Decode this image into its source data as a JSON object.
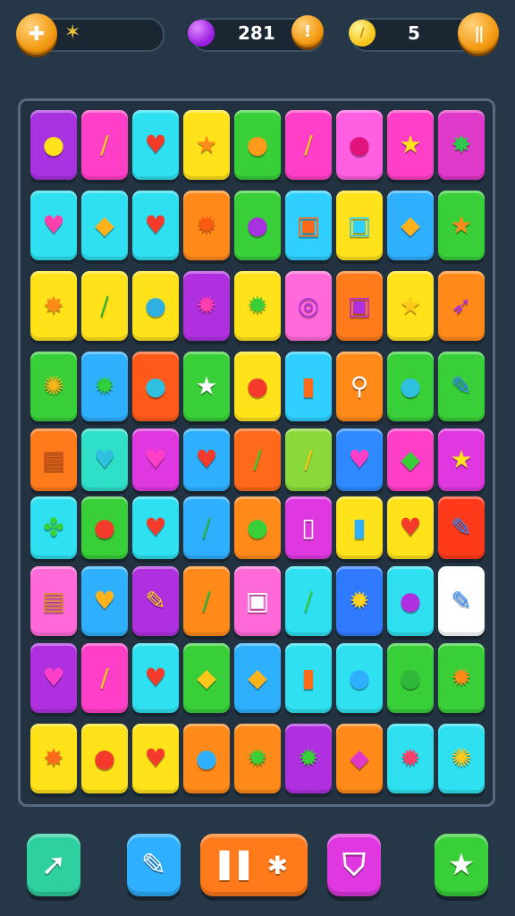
{
  "hud": {
    "left": {
      "button_icon": "plus-icon",
      "button_glyph": "✚",
      "badge_icon": "sparkle-icon",
      "badge_glyph": "✶"
    },
    "center": {
      "gem_icon": "purple-gem-icon",
      "value": "281",
      "button_icon": "info-icon",
      "button_glyph": "!"
    },
    "right": {
      "coin_icon": "gold-coin-icon",
      "coin_glyph": "/",
      "value": "5",
      "button_icon": "pause-icon",
      "button_glyph": "||"
    }
  },
  "board": {
    "rows": [
      [
        [
          "#a832e0",
          "lemon-icon",
          "●",
          "#ffe21a"
        ],
        [
          "#ff3fc8",
          "banana-icon",
          "/",
          "#ffd21f"
        ],
        [
          "#2fe0f0",
          "heart-icon",
          "♥",
          "#f43a2a"
        ],
        [
          "#ffe21a",
          "star-icon",
          "★",
          "#ff8a1a"
        ],
        [
          "#39cf39",
          "orange-icon",
          "●",
          "#ff9a1a"
        ],
        [
          "#ff3fc8",
          "banana-icon",
          "/",
          "#ffd21f"
        ],
        [
          "#ff5fe0",
          "berry-icon",
          "●",
          "#e0147a"
        ],
        [
          "#ff3fc8",
          "star-icon",
          "★",
          "#ffe21a"
        ],
        [
          "#e038c8",
          "leaf-star-icon",
          "✸",
          "#2fc84a"
        ]
      ],
      [
        [
          "#2fe0f0",
          "heart-icon",
          "♥",
          "#ff3fae"
        ],
        [
          "#2fe0f0",
          "leaf-icon",
          "◆",
          "#ffb21a"
        ],
        [
          "#2fe0f0",
          "heart-icon",
          "♥",
          "#f43a2a"
        ],
        [
          "#ff8a1a",
          "burst-icon",
          "✹",
          "#ff5a12"
        ],
        [
          "#39cf39",
          "potion-icon",
          "●",
          "#a832e0"
        ],
        [
          "#2fd0ff",
          "jar-icon",
          "▣",
          "#ff6a1a"
        ],
        [
          "#ffe21a",
          "jar-icon",
          "▣",
          "#2fd0ff"
        ],
        [
          "#2fb0ff",
          "leaf-icon",
          "◆",
          "#ffb21a"
        ],
        [
          "#39cf39",
          "star-icon",
          "★",
          "#ff8a1a"
        ]
      ],
      [
        [
          "#ffe21a",
          "leaf-star-icon",
          "✸",
          "#ff8a1a"
        ],
        [
          "#ffe21a",
          "cucumber-icon",
          "/",
          "#2fb83a"
        ],
        [
          "#ffe21a",
          "splash-icon",
          "●",
          "#2fb0e0"
        ],
        [
          "#b030e0",
          "burst-icon",
          "✹",
          "#ff3fae"
        ],
        [
          "#ffe21a",
          "burst-icon",
          "✹",
          "#39cf39"
        ],
        [
          "#ff6ad8",
          "ring-icon",
          "◎",
          "#b030e0"
        ],
        [
          "#ff7a1a",
          "ring-icon",
          "▣",
          "#b030e0"
        ],
        [
          "#ffe21a",
          "star-icon",
          "★",
          "#ffc81a"
        ],
        [
          "#ff8a1a",
          "rocket-icon",
          "➶",
          "#b030e0"
        ]
      ],
      [
        [
          "#39cf39",
          "gear-icon",
          "✺",
          "#ffb21a"
        ],
        [
          "#2fb0ff",
          "burst-icon",
          "✹",
          "#2fd03a"
        ],
        [
          "#ff5a1a",
          "splash-icon",
          "●",
          "#2fc0e0"
        ],
        [
          "#39cf39",
          "star-icon",
          "★",
          "#ffffff"
        ],
        [
          "#ffe21a",
          "strawberry-icon",
          "●",
          "#f43a2a"
        ],
        [
          "#2fd0ff",
          "bottle-icon",
          "▮",
          "#ff6a1a"
        ],
        [
          "#ff8a1a",
          "key-icon",
          "⚲",
          "#ffffff"
        ],
        [
          "#39cf39",
          "splash-icon",
          "●",
          "#2fc0e0"
        ],
        [
          "#39cf39",
          "pencil-icon",
          "✎",
          "#2f8aff"
        ]
      ],
      [
        [
          "#ff7a1a",
          "chocolate-icon",
          "▤",
          "#c8501a"
        ],
        [
          "#2fe0c8",
          "heart-icon",
          "♥",
          "#2fc0e0"
        ],
        [
          "#e038e0",
          "heart-icon",
          "♥",
          "#ff3fc8"
        ],
        [
          "#2fb0ff",
          "heart-icon",
          "♥",
          "#f43a2a"
        ],
        [
          "#ff6a1a",
          "cucumber-icon",
          "/",
          "#39cf39"
        ],
        [
          "#8ad83a",
          "banana-icon",
          "/",
          "#ffc81a"
        ],
        [
          "#2f8aff",
          "heart-icon",
          "♥",
          "#ff3fc8"
        ],
        [
          "#ff3fc8",
          "leaf-icon",
          "◆",
          "#39cf39"
        ],
        [
          "#e038e0",
          "star-icon",
          "★",
          "#ffe21a"
        ]
      ],
      [
        [
          "#2fe0f0",
          "popsicle-icon",
          "✤",
          "#39cf39"
        ],
        [
          "#39cf39",
          "apple-icon",
          "●",
          "#f43a2a"
        ],
        [
          "#2fe0f0",
          "heart-icon",
          "♥",
          "#f43a2a"
        ],
        [
          "#2fb0ff",
          "cucumber-icon",
          "/",
          "#2fb83a"
        ],
        [
          "#ff8a1a",
          "lime-icon",
          "●",
          "#39cf39"
        ],
        [
          "#e038e0",
          "can-icon",
          "▯",
          "#ffffff"
        ],
        [
          "#ffe21a",
          "juice-icon",
          "▮",
          "#2fb0ff"
        ],
        [
          "#ffe21a",
          "heart-icon",
          "♥",
          "#f43a2a"
        ],
        [
          "#ff3a1a",
          "pencil-icon",
          "✎",
          "#2f8aff"
        ]
      ],
      [
        [
          "#ff6ad8",
          "chocolate-icon",
          "▤",
          "#d8882a"
        ],
        [
          "#2fb0ff",
          "heart-icon",
          "♥",
          "#ffb21a"
        ],
        [
          "#b030e0",
          "pencil-icon",
          "✎",
          "#ffd21f"
        ],
        [
          "#ff8a1a",
          "cucumber-icon",
          "/",
          "#2fb83a"
        ],
        [
          "#ff6ad8",
          "jar-icon",
          "▣",
          "#ffffff"
        ],
        [
          "#2fe0f0",
          "cucumber-icon",
          "/",
          "#39cf39"
        ],
        [
          "#2f7aff",
          "burst-icon",
          "✹",
          "#ffd21f"
        ],
        [
          "#2fe0f0",
          "potion-icon",
          "●",
          "#b030e0"
        ],
        [
          "#ffffff",
          "pencil-icon",
          "✎",
          "#2f8aff"
        ]
      ],
      [
        [
          "#b030e0",
          "heart-icon",
          "♥",
          "#ff3fc8"
        ],
        [
          "#ff3fc8",
          "banana-icon",
          "/",
          "#ffd21f"
        ],
        [
          "#2fe0f0",
          "heart-icon",
          "♥",
          "#f43a2a"
        ],
        [
          "#39cf39",
          "leaf-icon",
          "◆",
          "#ffc81a"
        ],
        [
          "#2fb0ff",
          "leaf-icon",
          "◆",
          "#ffb21a"
        ],
        [
          "#2fe0f0",
          "bottle-icon",
          "▮",
          "#ff6a1a"
        ],
        [
          "#2fe0f0",
          "splash-icon",
          "●",
          "#2fb0ff"
        ],
        [
          "#39cf39",
          "lime-icon",
          "●",
          "#2fb83a"
        ],
        [
          "#39cf39",
          "burst-icon",
          "✹",
          "#ff8a1a"
        ]
      ],
      [
        [
          "#ffe21a",
          "star-icon",
          "✸",
          "#ff6a1a"
        ],
        [
          "#ffe21a",
          "apple-icon",
          "●",
          "#f43a2a"
        ],
        [
          "#ffe21a",
          "heart-icon",
          "♥",
          "#f43a2a"
        ],
        [
          "#ff8a1a",
          "drop-icon",
          "●",
          "#2fb0ff"
        ],
        [
          "#ff8a1a",
          "burst-icon",
          "✹",
          "#39cf39"
        ],
        [
          "#b030e0",
          "burst-icon",
          "✹",
          "#39cf39"
        ],
        [
          "#ff8a1a",
          "leaf-icon",
          "◆",
          "#e038c8"
        ],
        [
          "#2fe0f0",
          "burst-icon",
          "✹",
          "#ff3f6a"
        ],
        [
          "#2fe0f0",
          "gear-icon",
          "✺",
          "#ffc81a"
        ]
      ]
    ]
  },
  "toolbar": [
    {
      "name": "arrow-booster-button",
      "icon": "arrow-icon",
      "glyph": "➚",
      "color": "#2fd0a0"
    },
    {
      "name": "pencil-booster-button",
      "icon": "pencil-icon",
      "glyph": "✎",
      "color": "#2fb0ff"
    },
    {
      "name": "shuffle-booster-button",
      "icon": "bars-splash-icon",
      "glyph": "▌▌ ✱",
      "color": "#ff7a1a"
    },
    {
      "name": "shield-booster-button",
      "icon": "shield-icon",
      "glyph": "⛉",
      "color": "#e038e0"
    },
    {
      "name": "star-booster-button",
      "icon": "star-icon",
      "glyph": "★",
      "color": "#39cf39"
    }
  ]
}
